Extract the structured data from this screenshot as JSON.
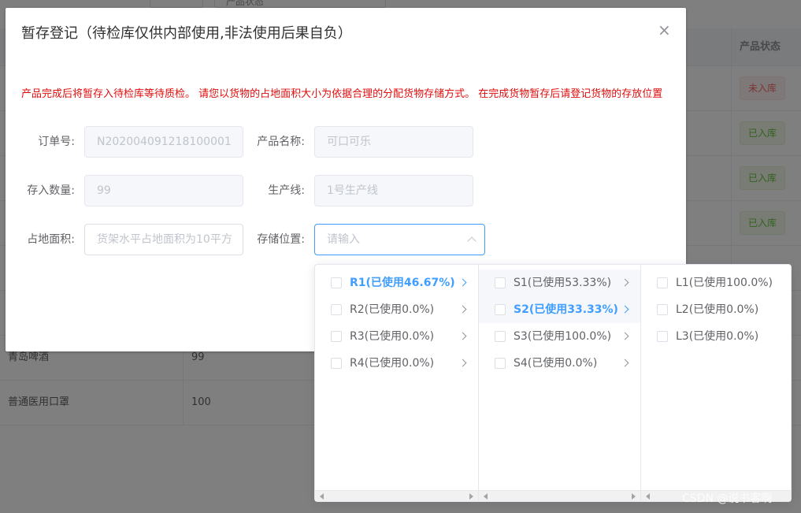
{
  "background": {
    "filter_select_text": "产品状态",
    "table_header_status": "产品状态",
    "rows": [
      {
        "status": "未入库",
        "kind": "danger"
      },
      {
        "status": "已入库",
        "kind": "success"
      },
      {
        "status": "已入库",
        "kind": "success"
      },
      {
        "status": "已入库",
        "kind": "success"
      },
      {
        "status": "",
        "kind": "success"
      },
      {
        "status": "",
        "kind": "success"
      }
    ],
    "visible_rows": [
      {
        "name": "青岛啤酒",
        "qty": "99"
      },
      {
        "name": "普通医用口罩",
        "qty": "100"
      }
    ]
  },
  "dialog": {
    "title": "暂存登记（待检库仅供内部使用,非法使用后果自负）",
    "close_glyph": "×",
    "notice": "产品完成后将暂存入待检库等待质检。 请您以货物的占地面积大小为依据合理的分配货物存储方式。 在完成货物暂存后请登记货物的存放位置",
    "fields": {
      "order_no": {
        "label": "订单号:",
        "value": "N202004091218100001"
      },
      "product_name": {
        "label": "产品名称:",
        "value": "可口可乐"
      },
      "quantity": {
        "label": "存入数量:",
        "value": "99"
      },
      "production_line": {
        "label": "生产线:",
        "value": "1号生产线"
      },
      "floor_area": {
        "label": "占地面积:",
        "placeholder": "货架水平占地面积为10平方"
      },
      "storage_location": {
        "label": "存储位置:",
        "placeholder": "请输入"
      }
    }
  },
  "cascader": {
    "panels": [
      {
        "items": [
          {
            "label": "R1(已使用46.67%)",
            "active": true,
            "has_children": true
          },
          {
            "label": "R2(已使用0.0%)",
            "active": false,
            "has_children": true
          },
          {
            "label": "R3(已使用0.0%)",
            "active": false,
            "has_children": true
          },
          {
            "label": "R4(已使用0.0%)",
            "active": false,
            "has_children": true
          }
        ]
      },
      {
        "items": [
          {
            "label": "S1(已使用53.33%)",
            "active": false,
            "has_children": true
          },
          {
            "label": "S2(已使用33.33%)",
            "active": true,
            "has_children": true
          },
          {
            "label": "S3(已使用100.0%)",
            "active": false,
            "has_children": true
          },
          {
            "label": "S4(已使用0.0%)",
            "active": false,
            "has_children": true
          }
        ]
      },
      {
        "items": [
          {
            "label": "L1(已使用100.0%)",
            "active": false,
            "has_children": false
          },
          {
            "label": "L2(已使用0.0%)",
            "active": false,
            "has_children": false
          },
          {
            "label": "L3(已使用0.0%)",
            "active": false,
            "has_children": false
          }
        ]
      }
    ]
  },
  "watermark": "CSDN @说书客啊",
  "colors": {
    "primary": "#409eff",
    "notice_red": "#e00d0d",
    "danger": "#f56c6c",
    "success": "#67c23a"
  }
}
